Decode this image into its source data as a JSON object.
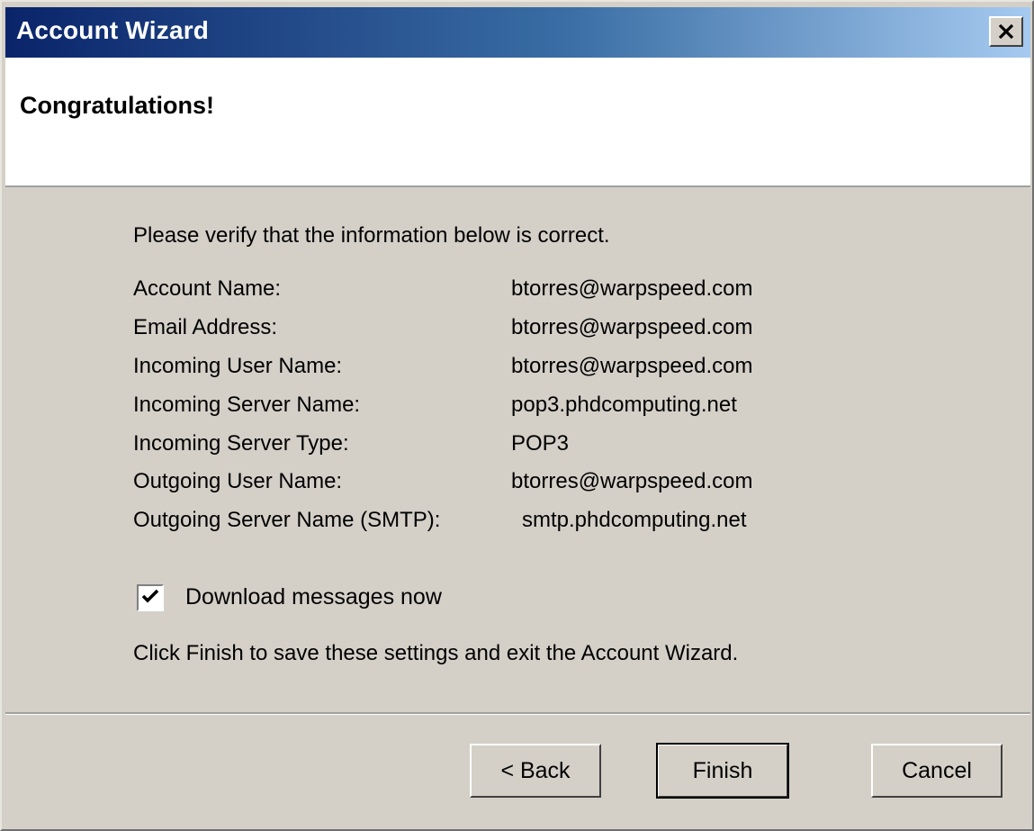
{
  "window": {
    "title": "Account Wizard"
  },
  "header": {
    "title": "Congratulations!"
  },
  "content": {
    "intro": "Please verify that the information below is correct.",
    "fields": [
      {
        "label": "Account Name:",
        "value": "btorres@warpspeed.com"
      },
      {
        "label": "Email Address:",
        "value": "btorres@warpspeed.com"
      },
      {
        "label": "Incoming User Name:",
        "value": "btorres@warpspeed.com"
      },
      {
        "label": "Incoming Server Name:",
        "value": "pop3.phdcomputing.net"
      },
      {
        "label": "Incoming Server Type:",
        "value": "POP3"
      },
      {
        "label": "Outgoing User Name:",
        "value": "btorres@warpspeed.com"
      },
      {
        "label": "Outgoing Server Name (SMTP):",
        "value": "smtp.phdcomputing.net"
      }
    ],
    "download_checkbox": {
      "label": "Download messages now",
      "checked": true
    },
    "finish_note": "Click Finish to save these settings and exit the Account Wizard."
  },
  "buttons": {
    "back": "< Back",
    "finish": "Finish",
    "cancel": "Cancel"
  },
  "icons": {
    "close": "close-icon",
    "check": "checkmark-icon"
  },
  "colors": {
    "titlebar_start": "#0a246a",
    "titlebar_end": "#a6caf0",
    "dialog_bg": "#d4d0c8"
  }
}
